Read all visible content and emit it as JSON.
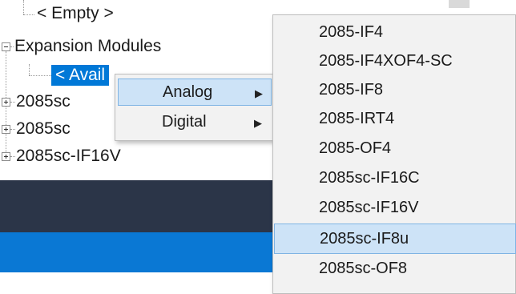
{
  "tree": {
    "empty_label": "< Empty >",
    "expansion_modules_label": "Expansion Modules",
    "available_label": "< Avail",
    "children": [
      {
        "label": "2085sc"
      },
      {
        "label": "2085sc"
      },
      {
        "label": "2085sc-IF16V"
      }
    ]
  },
  "context_menu": {
    "items": [
      {
        "label": "Analog",
        "arrow": "▶"
      },
      {
        "label": "Digital",
        "arrow": "▶"
      }
    ]
  },
  "submenu": {
    "items": [
      {
        "label": "2085-IF4"
      },
      {
        "label": "2085-IF4XOF4-SC"
      },
      {
        "label": "2085-IF8"
      },
      {
        "label": "2085-IRT4"
      },
      {
        "label": "2085-OF4"
      },
      {
        "label": "2085sc-IF16C"
      },
      {
        "label": "2085sc-IF16V"
      },
      {
        "label": "2085sc-IF8u"
      },
      {
        "label": "2085sc-OF8"
      }
    ],
    "highlighted_index": 7
  },
  "colors": {
    "selection": "#0078d7",
    "menu_background": "#f2f2f2",
    "menu_highlight": "#cde3f7",
    "dark_band": "#2b3548",
    "blue_band": "#0a78d4"
  }
}
